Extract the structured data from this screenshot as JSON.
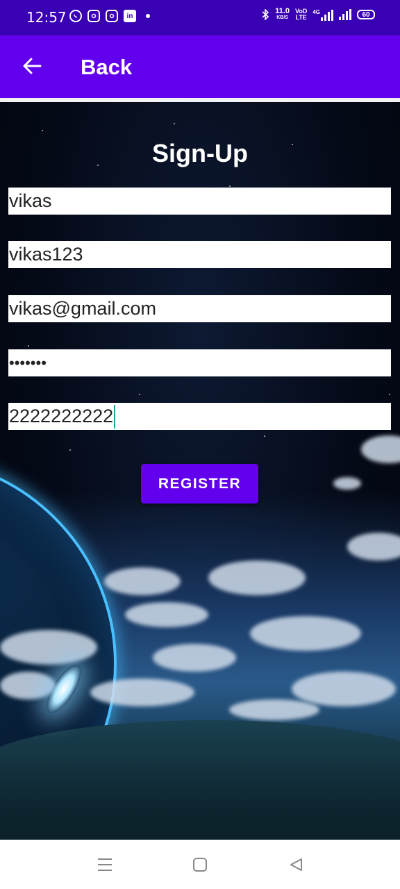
{
  "status_bar": {
    "time": "12:57",
    "net_speed_value": "11.0",
    "net_speed_unit": "KB/S",
    "volte_label_top": "VoD",
    "volte_label_bottom": "LTE",
    "network_type": "4G",
    "battery_level": "60",
    "notification_icons": [
      "whatsapp-icon",
      "instagram-icon",
      "instagram-icon",
      "linkedin-icon"
    ]
  },
  "app_bar": {
    "title": "Back",
    "background_color": "#6200ee"
  },
  "form": {
    "title": "Sign-Up",
    "fields": [
      {
        "name": "name",
        "value": "vikas"
      },
      {
        "name": "username",
        "value": "vikas123"
      },
      {
        "name": "email",
        "value": "vikas@gmail.com"
      },
      {
        "name": "password",
        "value": "•••••••"
      },
      {
        "name": "phone",
        "value": "2222222222"
      }
    ],
    "register_label": "REGISTER",
    "button_color": "#6200ee"
  },
  "nav_bar": {
    "buttons": [
      "menu-icon",
      "home-icon",
      "back-icon"
    ]
  }
}
